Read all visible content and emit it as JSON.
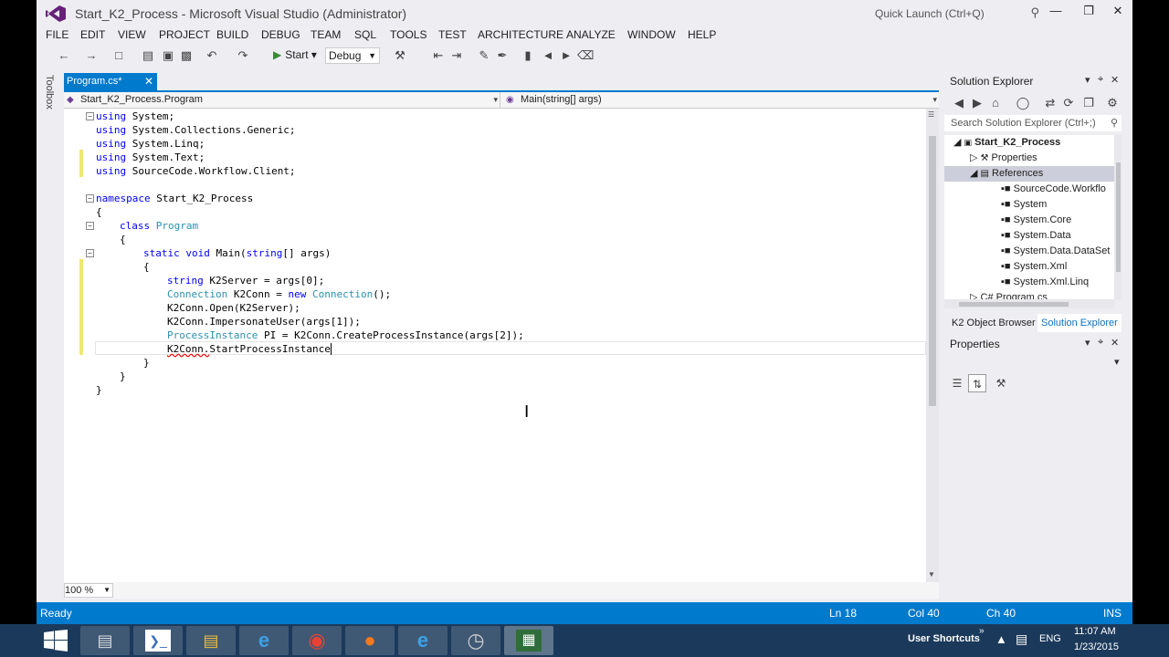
{
  "window": {
    "title": "Start_K2_Process - Microsoft Visual Studio (Administrator)",
    "quick_launch_placeholder": "Quick Launch (Ctrl+Q)"
  },
  "menu": [
    "FILE",
    "EDIT",
    "VIEW",
    "PROJECT",
    "BUILD",
    "DEBUG",
    "TEAM",
    "SQL",
    "TOOLS",
    "TEST",
    "ARCHITECTURE",
    "ANALYZE",
    "WINDOW",
    "HELP"
  ],
  "toolbar": {
    "start_label": "Start",
    "config_value": "Debug"
  },
  "toolbox": {
    "label": "Toolbox"
  },
  "document_tab": {
    "label": "Program.cs*"
  },
  "navbar": {
    "type_value": "Start_K2_Process.Program",
    "member_value": "Main(string[] args)"
  },
  "code": {
    "l1_kw": "using",
    "l1_rest": " System;",
    "l2_kw": "using",
    "l2_rest": " System.Collections.Generic;",
    "l3_kw": "using",
    "l3_rest": " System.Linq;",
    "l4_kw": "using",
    "l4_rest": " System.Text;",
    "l5_kw": "using",
    "l5_rest": " SourceCode.Workflow.Client;",
    "l7_kw": "namespace",
    "l7_rest": " Start_K2_Process",
    "l8": "{",
    "l9_kw": "class",
    "l9_ty": " Program",
    "l10": "{",
    "l11_kw": "static void",
    "l11_rest": " Main(",
    "l11_kw2": "string",
    "l11_rest2": "[] args)",
    "l12": "{",
    "l13_kw": "string",
    "l13_rest": " K2Server = args[0];",
    "l14_ty": "Connection",
    "l14_rest": " K2Conn = ",
    "l14_kw": "new",
    "l14_ty2": " Connection",
    "l14_rest2": "();",
    "l15": "K2Conn.Open(K2Server);",
    "l16": "K2Conn.ImpersonateUser(args[1]);",
    "l17_ty": "ProcessInstance",
    "l17_rest": " PI = K2Conn.CreateProcessInstance(args[2]);",
    "l18_sq": "K2Conn.",
    "l18_rest": "StartProcessInstance",
    "l19": "}",
    "l20": "}",
    "l21": "}"
  },
  "zoom": {
    "value": "100 %"
  },
  "solution_explorer": {
    "title": "Solution Explorer",
    "search_placeholder": "Search Solution Explorer (Ctrl+;)",
    "tree": [
      "Start_K2_Process",
      "Properties",
      "References",
      "SourceCode.Workflo",
      "System",
      "System.Core",
      "System.Data",
      "System.Data.DataSet",
      "System.Xml",
      "System.Xml.Linq",
      "Program.cs"
    ],
    "tabs": [
      "K2 Object Browser",
      "Solution Explorer"
    ]
  },
  "properties": {
    "title": "Properties"
  },
  "status": {
    "ready": "Ready",
    "line": "Ln 18",
    "col": "Col 40",
    "ch": "Ch 40",
    "mode": "INS"
  },
  "taskbar": {
    "user_shortcuts": "User Shortcuts",
    "lang": "ENG",
    "time": "11:07 AM",
    "date": "1/23/2015"
  },
  "colors": {
    "accent": "#007acc",
    "keyword": "#0000ff",
    "type": "#2b91af",
    "taskbar": "#1b3a5b"
  }
}
